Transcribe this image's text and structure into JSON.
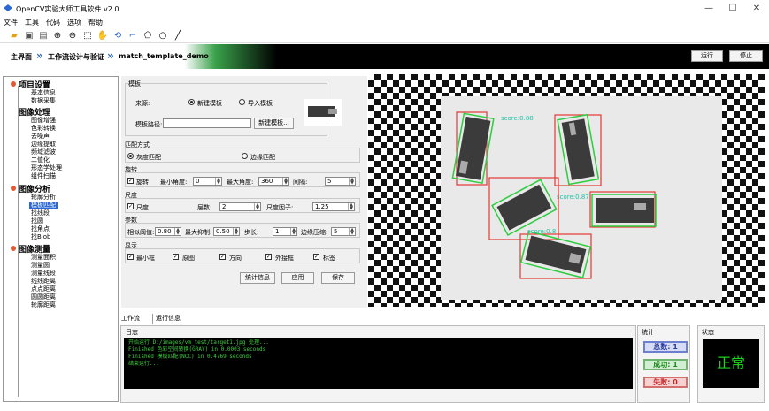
{
  "window": {
    "title": "OpenCV实验大师工具软件 v2.0",
    "min": "—",
    "max": "☐",
    "close": "✕"
  },
  "menu": [
    "文件",
    "工具",
    "代码",
    "选项",
    "帮助"
  ],
  "toolbar": [
    "folder-open",
    "save",
    "clipboard",
    "zoom-in",
    "zoom-out",
    "select",
    "hand",
    "rotate",
    "crop",
    "polygon",
    "circle",
    "line"
  ],
  "breadcrumb": {
    "home": "主界面",
    "sep": "»",
    "workflow": "工作流设计与验证",
    "current": "match_template_demo"
  },
  "top_buttons": {
    "run": "运行",
    "stop": "停止"
  },
  "tree": [
    {
      "group": "项目设置",
      "items": [
        "基本信息",
        "数据采集"
      ]
    },
    {
      "group": "图像处理",
      "items": [
        "图像增强",
        "色彩转换",
        "去噪声",
        "边缘提取",
        "频域滤波",
        "二值化",
        "形态学处理",
        "组件扫描"
      ]
    },
    {
      "group": "图像分析",
      "items": [
        "轮廓分析",
        "模板匹配",
        "找线段",
        "找圆",
        "找角点",
        "找Blob"
      ]
    },
    {
      "group": "图像测量",
      "items": [
        "测量面积",
        "测量圆",
        "测量线段",
        "线线距离",
        "点点距离",
        "圆圆距离",
        "轮廓距离"
      ]
    }
  ],
  "form": {
    "template_section": "模板",
    "source_label": "来源:",
    "opt_new": "新建模板",
    "opt_import": "导入模板",
    "path_label": "模板路径:",
    "path_value": "",
    "new_template_btn": "新建模板...",
    "match_mode_section": "匹配方式",
    "opt_gray": "灰度匹配",
    "opt_edge": "边缘匹配",
    "rotate_section": "旋转",
    "rotate_cb": "旋转",
    "min_angle_label": "最小角度:",
    "min_angle": "0",
    "max_angle_label": "最大角度:",
    "max_angle": "360",
    "step_label": "间隔:",
    "step": "5",
    "scale_section": "尺度",
    "scale_cb": "尺度",
    "levels_label": "层数:",
    "levels": "2",
    "scale_factor_label": "尺度因子:",
    "scale_factor": "1.25",
    "params_section": "参数",
    "thresh_label": "相似阈值:",
    "thresh": "0.80",
    "nms_label": "最大抑制:",
    "nms": "0.50",
    "pstep_label": "步长:",
    "pstep": "1",
    "edge_comp_label": "边缘压缩:",
    "edge_comp": "5",
    "display_section": "显示",
    "show_min_box": "最小框",
    "show_outline": "原图",
    "show_direction": "方向",
    "show_bbox": "外接框",
    "show_label": "标签",
    "stats_btn": "统计信息",
    "apply_btn": "应用",
    "save_btn": "保存"
  },
  "detections": [
    "score:0.88",
    "score:0.87",
    "score:0.8",
    "score:0.8"
  ],
  "tabs": [
    "工作流",
    "运行信息"
  ],
  "log": {
    "title": "日志",
    "lines": [
      "开始运行 D:/images/vm_test/target1.jpg 处理...",
      "Finished 色彩空间转换(GRAY) in 0.0003 seconds",
      "Finished 模板匹配(NCC) in 0.4769 seconds",
      "结束运行..."
    ]
  },
  "stats": {
    "title": "统计",
    "total": "总数: 1",
    "ok": "成功: 1",
    "fail": "失败: 0"
  },
  "status": {
    "title": "状态",
    "value": "正常"
  },
  "colors": {
    "accent": "#2a68d6",
    "ok": "#19d419",
    "fail": "#e53935",
    "banner_green": "#3aa14b"
  }
}
